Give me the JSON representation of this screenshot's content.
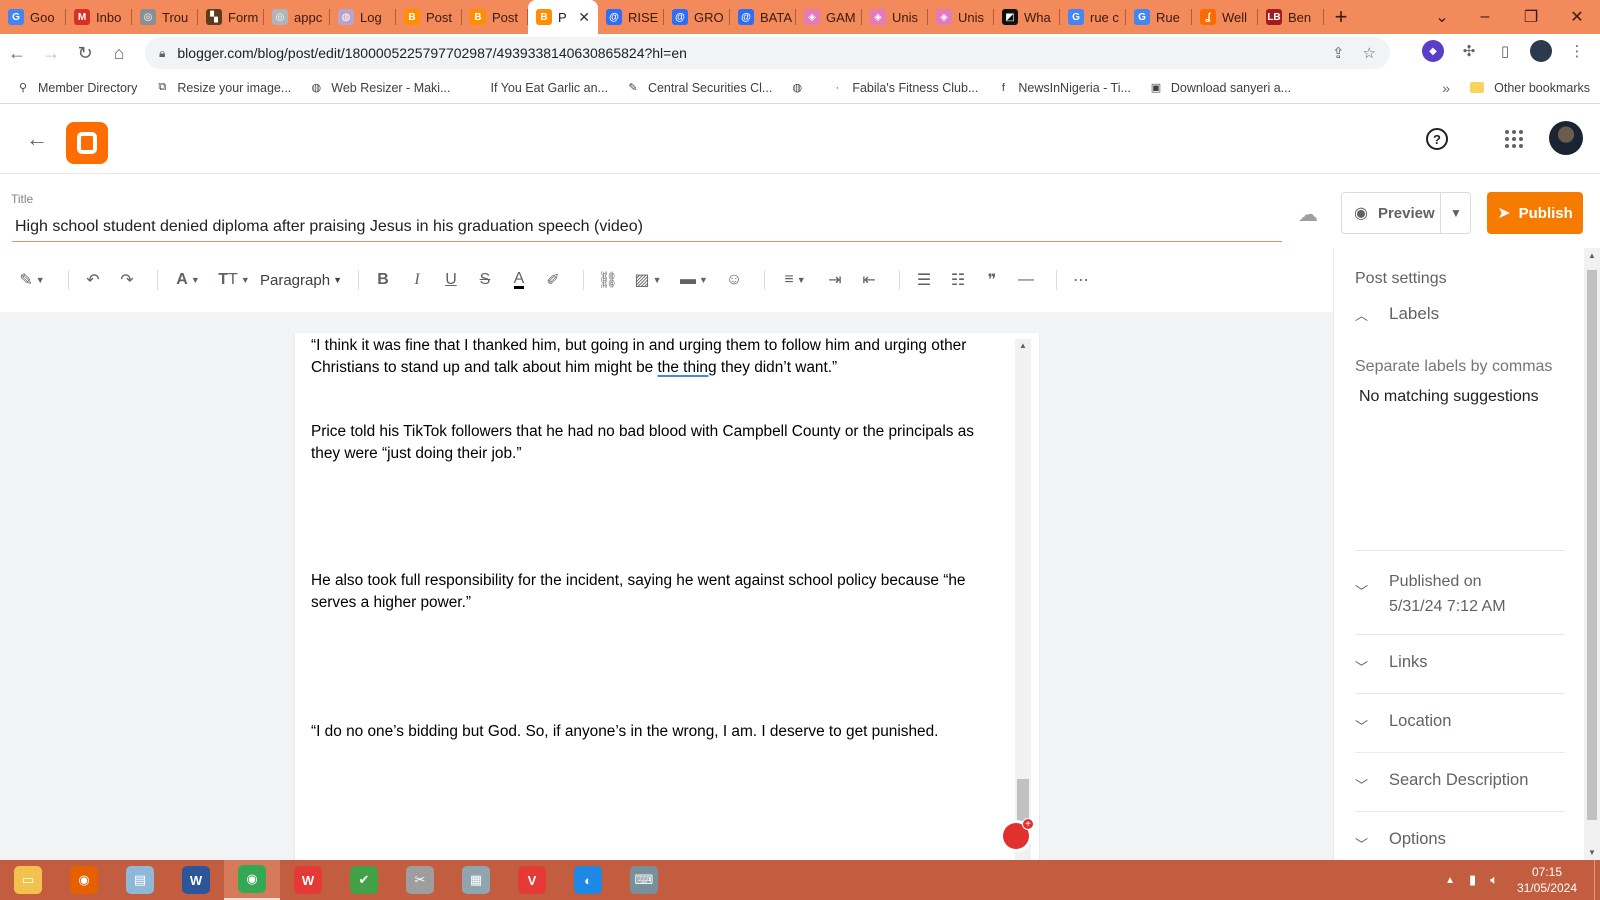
{
  "browser": {
    "tabs": [
      {
        "label": "Goo",
        "color": "#4285f4",
        "glyph": "G"
      },
      {
        "label": "Inbo",
        "color": "#d93025",
        "glyph": "M"
      },
      {
        "label": "Trou",
        "color": "#8a8f96",
        "glyph": "◎"
      },
      {
        "label": "Form",
        "color": "#5f3b1e",
        "glyph": "▚"
      },
      {
        "label": "appc",
        "color": "#b0b3b8",
        "glyph": "◎"
      },
      {
        "label": "Log",
        "color": "#b9a3c9",
        "glyph": "◍"
      },
      {
        "label": "Post",
        "color": "#ff8f00",
        "glyph": "B"
      },
      {
        "label": "Post",
        "color": "#ff8f00",
        "glyph": "B"
      },
      {
        "label": "P",
        "color": "#ff8f00",
        "glyph": "B",
        "active": true
      },
      {
        "label": "RISE",
        "color": "#2f6df6",
        "glyph": "@"
      },
      {
        "label": "GRO",
        "color": "#2f6df6",
        "glyph": "@"
      },
      {
        "label": "BATA",
        "color": "#2f6df6",
        "glyph": "@"
      },
      {
        "label": "GAM",
        "color": "#e57ab9",
        "glyph": "◈"
      },
      {
        "label": "Unis",
        "color": "#e57ab9",
        "glyph": "◈"
      },
      {
        "label": "Unis",
        "color": "#e57ab9",
        "glyph": "◈"
      },
      {
        "label": "Wha",
        "color": "#111111",
        "glyph": "◩"
      },
      {
        "label": "rue c",
        "color": "#4285f4",
        "glyph": "G"
      },
      {
        "label": "Rue",
        "color": "#4285f4",
        "glyph": "G"
      },
      {
        "label": "Well",
        "color": "#ff6a00",
        "glyph": "ʆ"
      },
      {
        "label": "Ben",
        "color": "#a11d1d",
        "glyph": "LB"
      }
    ],
    "url": "blogger.com/blog/post/edit/1800005225797702987/4939338140630865824?hl=en",
    "bookmarks": [
      {
        "label": "Member Directory",
        "icon": "⚲"
      },
      {
        "label": "Resize your image...",
        "icon": "⧉"
      },
      {
        "label": "Web Resizer - Maki...",
        "icon": "◍"
      },
      {
        "label": "If You Eat Garlic an...",
        "icon": ""
      },
      {
        "label": "Central Securities Cl...",
        "icon": "✎"
      },
      {
        "label": "",
        "icon": "◍"
      },
      {
        "label": "Fabila's Fitness Club...",
        "icon": "·"
      },
      {
        "label": "NewsInNigeria - Ti...",
        "icon": "f"
      },
      {
        "label": "Download sanyeri a...",
        "icon": "▣"
      }
    ],
    "bookmarks_more": "»",
    "other_bookmarks": "Other bookmarks"
  },
  "editor": {
    "title_label": "Title",
    "title_value": "High school student denied diploma after praising Jesus in his graduation speech (video)",
    "preview_label": "Preview",
    "publish_label": "Publish",
    "paragraph_style": "Paragraph",
    "body": {
      "p1_a": "“I think it was fine that I thanked him, but going in and urging them to follow him and urging other Christians to stand up and talk about him might be ",
      "p1_spell": "the thing",
      "p1_b": " they didn’t want.”",
      "p2": "Price told his TikTok followers that he had no bad blood with Campbell County or the principals as they were “just doing their job.”",
      "p3": "He also took full responsibility for the incident, saying he went against school policy because “he serves a higher power.”",
      "p4": "“I do no one’s bidding but God. So, if anyone’s in the wrong, I am. I deserve to get punished."
    }
  },
  "sidebar": {
    "title": "Post settings",
    "labels_heading": "Labels",
    "labels_placeholder": "Separate labels by commas",
    "no_suggestions": "No matching suggestions",
    "published_label": "Published on",
    "published_value": "5/31/24 7:12 AM",
    "links": "Links",
    "location": "Location",
    "search_description": "Search Description",
    "options": "Options"
  },
  "taskbar": {
    "apps": [
      {
        "name": "file-explorer",
        "color": "#f2c14e",
        "glyph": "▭"
      },
      {
        "name": "firefox",
        "color": "#e66000",
        "glyph": "◉"
      },
      {
        "name": "notepad",
        "color": "#8fb8d8",
        "glyph": "▤"
      },
      {
        "name": "word",
        "color": "#2b579a",
        "glyph": "W"
      },
      {
        "name": "chrome",
        "color": "#34a853",
        "glyph": "◉",
        "active": true
      },
      {
        "name": "wps-office",
        "color": "#e53935",
        "glyph": "W"
      },
      {
        "name": "green-app",
        "color": "#43a047",
        "glyph": "✔"
      },
      {
        "name": "snipping-tool",
        "color": "#9e9e9e",
        "glyph": "✂"
      },
      {
        "name": "calculator",
        "color": "#90a4ae",
        "glyph": "▦"
      },
      {
        "name": "vivaldi",
        "color": "#e53935",
        "glyph": "V"
      },
      {
        "name": "edge",
        "color": "#1e88e5",
        "glyph": "◐"
      },
      {
        "name": "on-screen-keyboard",
        "color": "#78909c",
        "glyph": "⌨"
      }
    ],
    "time": "07:15",
    "date": "31/05/2024"
  }
}
